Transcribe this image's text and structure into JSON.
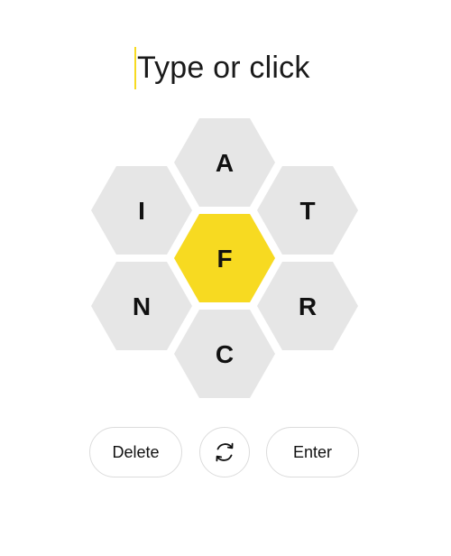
{
  "input": {
    "placeholder": "Type or click"
  },
  "hive": {
    "center_letter": "F",
    "outer_letters": {
      "top": "A",
      "upper_left": "I",
      "upper_right": "T",
      "lower_left": "N",
      "lower_right": "R",
      "bottom": "C"
    }
  },
  "controls": {
    "delete_label": "Delete",
    "shuffle_icon": "shuffle-icon",
    "enter_label": "Enter"
  },
  "colors": {
    "center": "#f7da21",
    "outer": "#e6e6e6",
    "cursor": "#f7da21"
  }
}
